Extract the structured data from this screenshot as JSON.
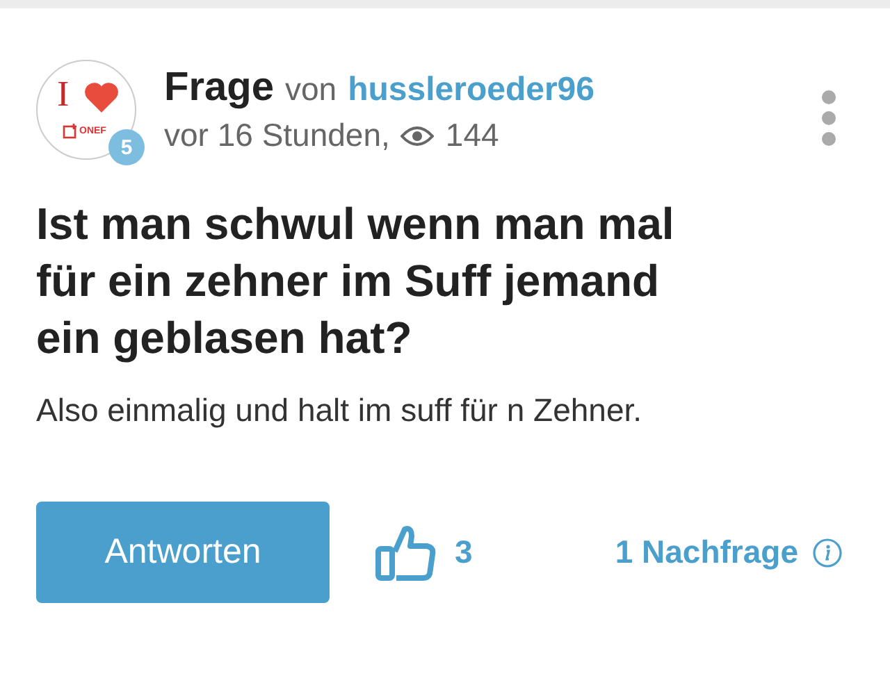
{
  "avatar": {
    "letter": "I",
    "brand": "ONEF",
    "badge": "5"
  },
  "header": {
    "kind_label": "Frage",
    "by": "von",
    "author": "hussleroeder96",
    "time": "vor 16 Stunden,",
    "views": "144"
  },
  "question": {
    "title": "Ist man schwul wenn man mal für ein zehner im Suff jemand ein geblasen hat?",
    "body": "Also einmalig und halt im suff für n Zehner."
  },
  "actions": {
    "answer_button": "Antworten",
    "likes": "3",
    "followups": "1 Nachfrage"
  }
}
